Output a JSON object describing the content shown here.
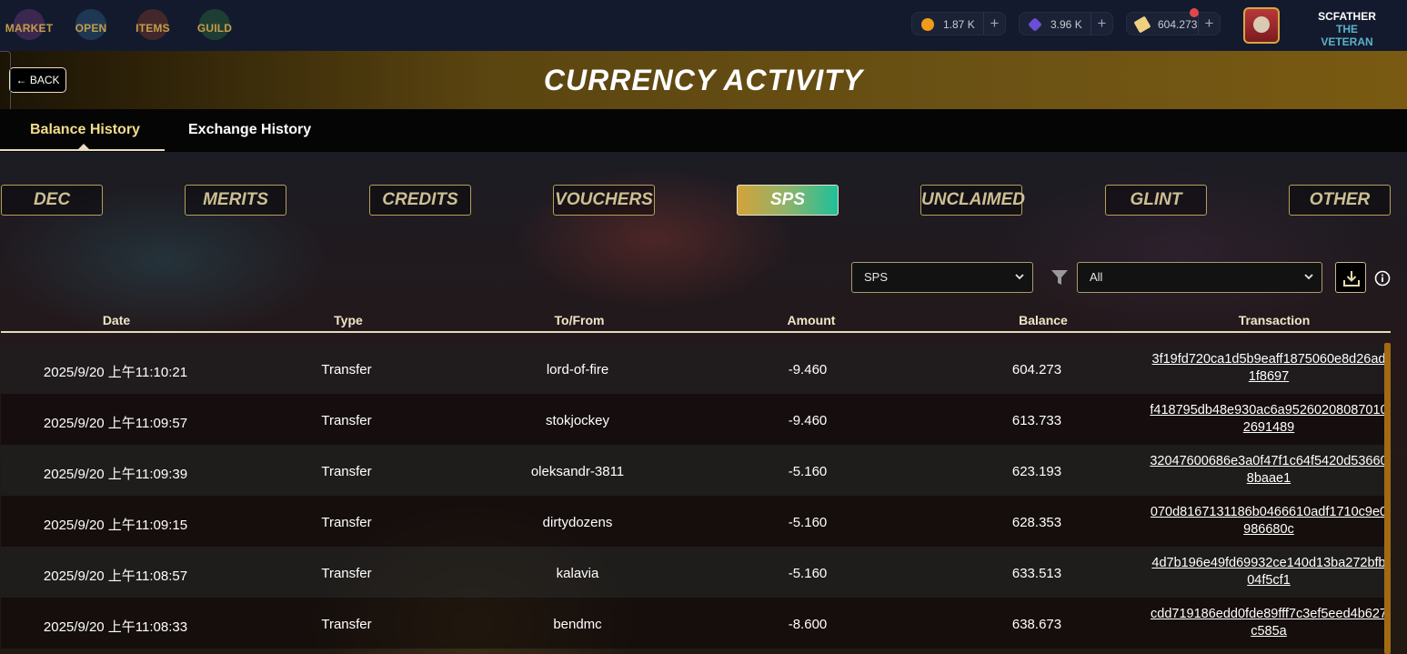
{
  "nav": {
    "items": [
      {
        "label": "MARKET",
        "icon": "market-emblem"
      },
      {
        "label": "OPEN",
        "icon": "open-emblem"
      },
      {
        "label": "ITEMS",
        "icon": "items-emblem"
      },
      {
        "label": "GUILD",
        "icon": "guild-emblem"
      }
    ]
  },
  "balances": [
    {
      "icon": "dec-coin-icon",
      "color": "#f29a1a",
      "value": "1.87 K"
    },
    {
      "icon": "merits-crystal-icon",
      "color": "#6a4fd6",
      "value": "3.96 K"
    },
    {
      "icon": "sps-shard-icon",
      "color": "#f0d080",
      "value": "604.273"
    }
  ],
  "user": {
    "name": "SCFATHER",
    "title": "THE VETERAN"
  },
  "header": {
    "title": "CURRENCY ACTIVITY",
    "back_label": "BACK"
  },
  "tabs": [
    {
      "label": "Balance History",
      "active": true
    },
    {
      "label": "Exchange History",
      "active": false
    }
  ],
  "currencies": [
    {
      "label": "DEC",
      "active": false
    },
    {
      "label": "MERITS",
      "active": false
    },
    {
      "label": "CREDITS",
      "active": false
    },
    {
      "label": "VOUCHERS",
      "active": false
    },
    {
      "label": "SPS",
      "active": true
    },
    {
      "label": "UNCLAIMED",
      "active": false
    },
    {
      "label": "GLINT",
      "active": false
    },
    {
      "label": "OTHER",
      "active": false
    }
  ],
  "filters": {
    "token_select": "SPS",
    "type_select": "All"
  },
  "table": {
    "columns": [
      "Date",
      "Type",
      "To/From",
      "Amount",
      "Balance",
      "Transaction"
    ],
    "rows": [
      {
        "date": "2025/9/20 上午11:10:21",
        "type": "Transfer",
        "to_from": "lord-of-fire",
        "amount": "-9.460",
        "balance": "604.273",
        "tx": "3f19fd720ca1d5b9eaff1875060e8d26ad1f8697"
      },
      {
        "date": "2025/9/20 上午11:09:57",
        "type": "Transfer",
        "to_from": "stokjockey",
        "amount": "-9.460",
        "balance": "613.733",
        "tx": "f418795db48e930ac6a952602080870102691489"
      },
      {
        "date": "2025/9/20 上午11:09:39",
        "type": "Transfer",
        "to_from": "oleksandr-3811",
        "amount": "-5.160",
        "balance": "623.193",
        "tx": "32047600686e3a0f47f1c64f5420d536608baae1"
      },
      {
        "date": "2025/9/20 上午11:09:15",
        "type": "Transfer",
        "to_from": "dirtydozens",
        "amount": "-5.160",
        "balance": "628.353",
        "tx": "070d8167131186b0466610adf1710c9e0986680c"
      },
      {
        "date": "2025/9/20 上午11:08:57",
        "type": "Transfer",
        "to_from": "kalavia",
        "amount": "-5.160",
        "balance": "633.513",
        "tx": "4d7b196e49fd69932ce140d13ba272bfb04f5cf1"
      },
      {
        "date": "2025/9/20 上午11:08:33",
        "type": "Transfer",
        "to_from": "bendmc",
        "amount": "-8.600",
        "balance": "638.673",
        "tx": "cdd719186edd0fde89fff7c3ef5eed4b627c585a"
      }
    ]
  }
}
